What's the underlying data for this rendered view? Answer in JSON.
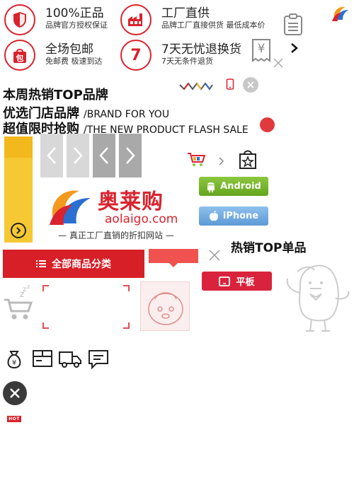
{
  "promises": {
    "genuine": {
      "title": "100%正品",
      "subtitle": "品牌官方授权保证"
    },
    "factory": {
      "title": "工厂直供",
      "subtitle": "品牌工厂直接供货 最低成本价"
    },
    "shipping": {
      "title": "全场包邮",
      "subtitle": "免邮费 极速到达",
      "badge": "包"
    },
    "returns": {
      "title": "7天无忧退换货",
      "subtitle": "7天无条件退货",
      "badge": "7"
    }
  },
  "headings": {
    "weekly_top": "本周热销TOP品牌",
    "select_brands": "优选门店品牌",
    "select_brands_en": "/BRAND FOR YOU",
    "flash_sale": "超值限时抢购",
    "flash_sale_en": "/THE NEW PRODUCT  FLASH SALE",
    "hot_top": "热销TOP单品"
  },
  "brand": {
    "name_cn": "奥莱购",
    "domain": "aolaigo.com",
    "tagline": "— 真正工厂直销的折扣网站 —"
  },
  "app_buttons": {
    "android": "Android",
    "iphone": "iPhone"
  },
  "category": {
    "label": "全部商品分类"
  },
  "tablet": {
    "label": "平板"
  },
  "hot_badge": "HOT",
  "currency_symbol": "¥",
  "colors": {
    "accent": "#d71f27",
    "android": "#7ab82e",
    "iphone": "#72abe2",
    "yellow": "#f6c833"
  }
}
